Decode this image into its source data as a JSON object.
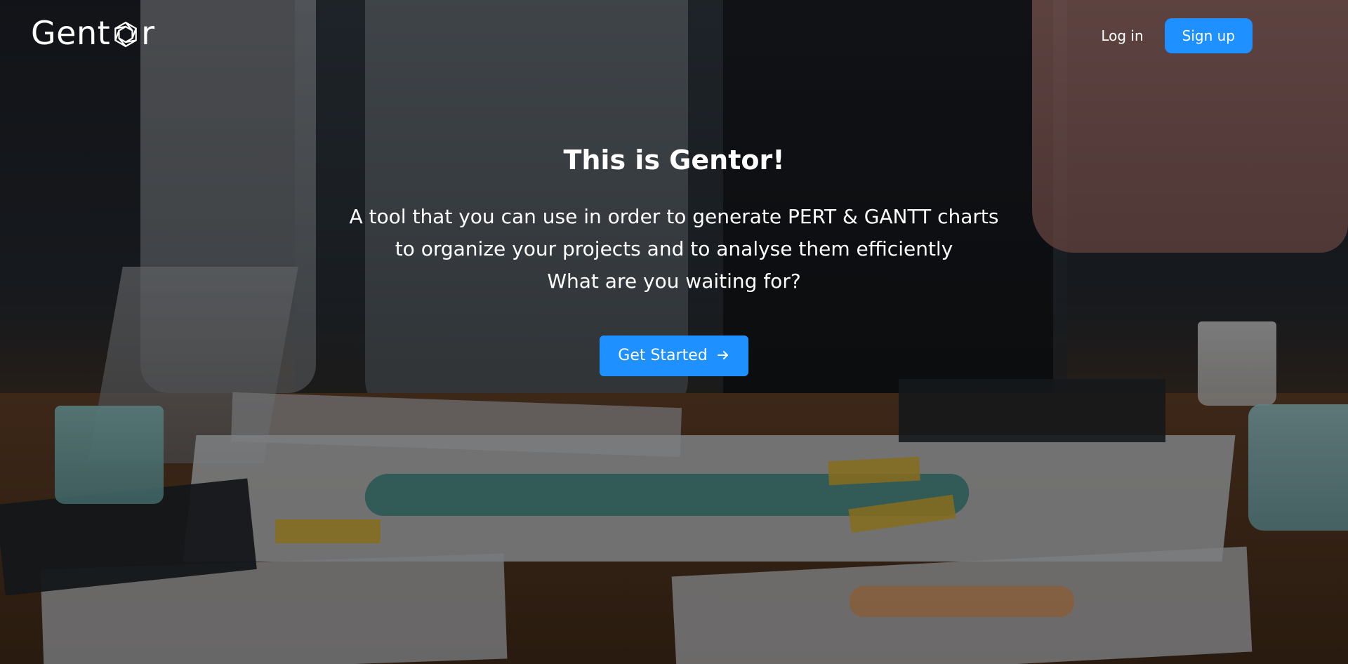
{
  "navbar": {
    "logo_text_start": "Gent",
    "logo_text_end": "r",
    "logo_icon": "hexagon-knot-icon",
    "login_label": "Log in",
    "signup_label": "Sign up"
  },
  "hero": {
    "title": "This is Gentor!",
    "lines": [
      "A tool that you can use in order to generate PERT & GANTT charts",
      "to organize your projects and to analyse them efficiently",
      "What are you waiting for?"
    ],
    "cta_label": "Get Started",
    "cta_icon": "arrow-right-icon"
  },
  "colors": {
    "accent": "#1e90ff",
    "text": "#ffffff"
  }
}
